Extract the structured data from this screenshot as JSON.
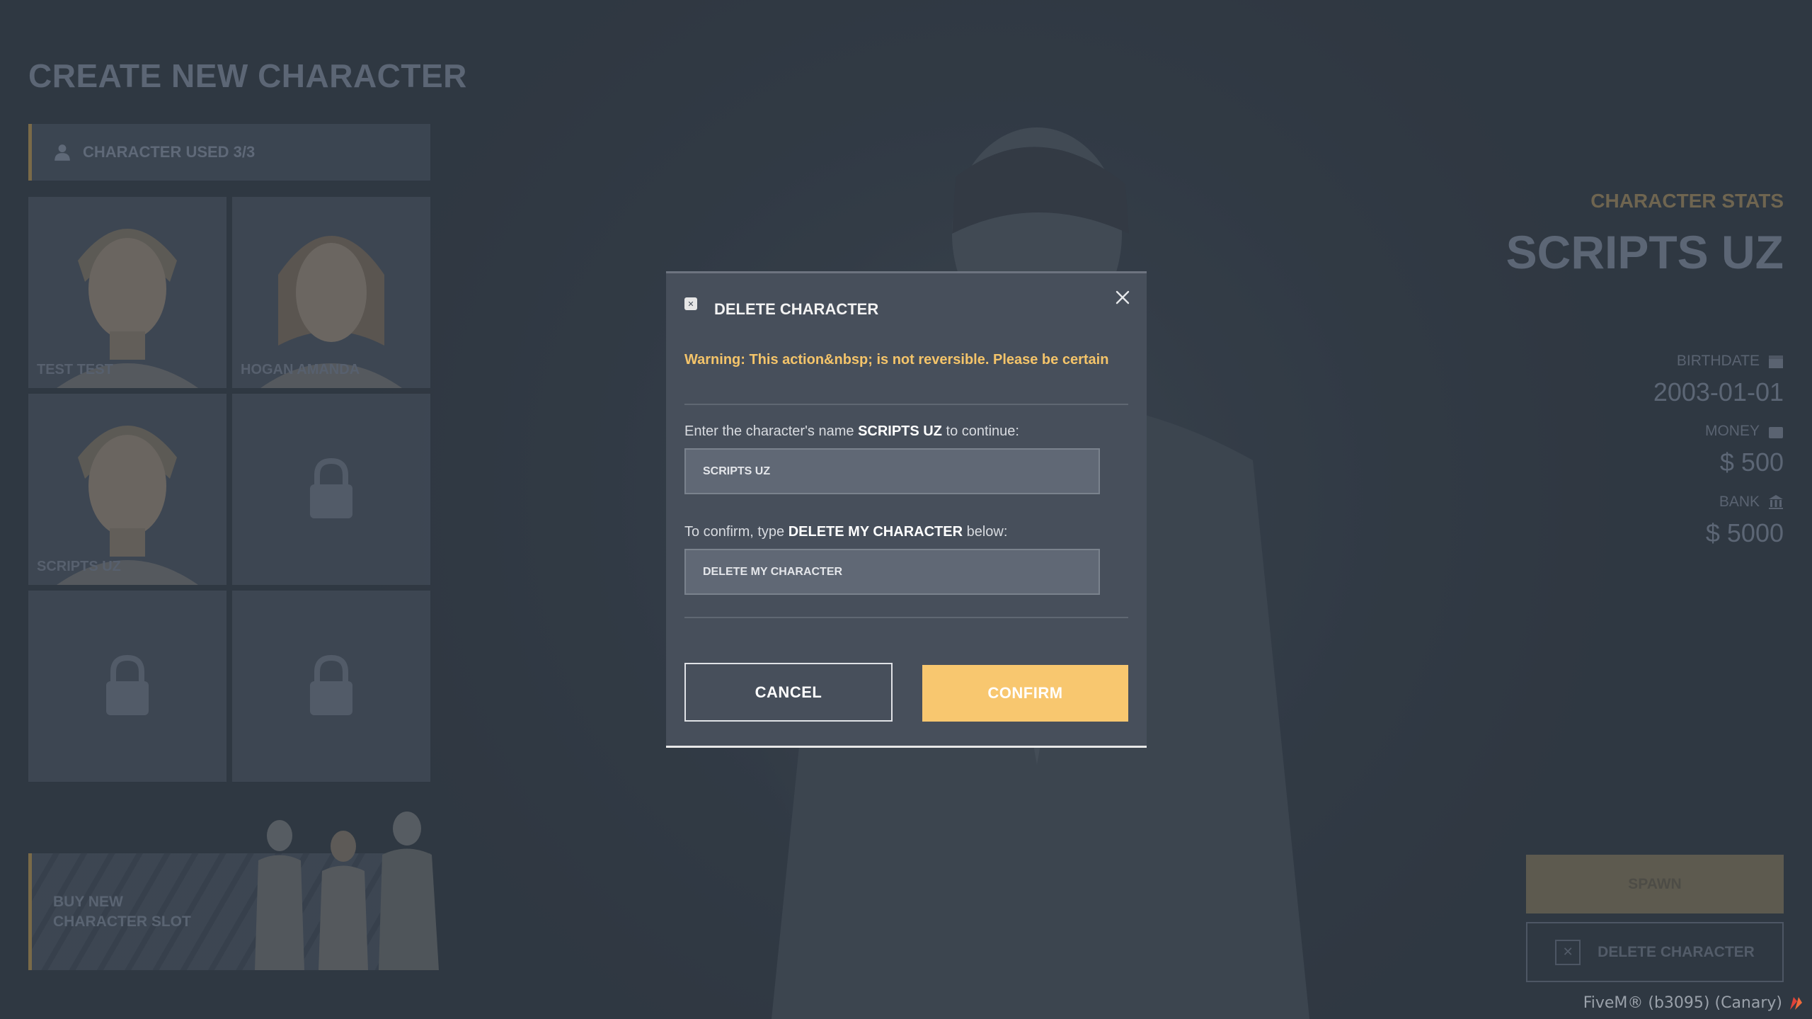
{
  "page": {
    "title": "CREATE NEW CHARACTER",
    "characters_used": "CHARACTER USED 3/3"
  },
  "slots": [
    {
      "name": "TEST TEST",
      "state": "filled"
    },
    {
      "name": "HOGAN AMANDA",
      "state": "filled"
    },
    {
      "name": "SCRIPTS UZ",
      "state": "filled"
    },
    {
      "name": "",
      "state": "locked"
    },
    {
      "name": "",
      "state": "locked"
    },
    {
      "name": "",
      "state": "locked"
    }
  ],
  "buy_slot": {
    "line1": "BUY NEW",
    "line2": "CHARACTER SLOT"
  },
  "stats": {
    "label": "CHARACTER STATS",
    "name": "SCRIPTS UZ",
    "birthdate_label": "BIRTHDATE",
    "birthdate": "2003-01-01",
    "money_label": "MONEY",
    "money": "$ 500",
    "bank_label": "BANK",
    "bank": "$ 5000"
  },
  "actions": {
    "spawn": "SPAWN",
    "delete": "DELETE CHARACTER"
  },
  "footer": {
    "fivem": "FiveM® (b3095) (Canary)"
  },
  "modal": {
    "title": "DELETE CHARACTER",
    "warning": "Warning: This action&nbsp; is not reversible. Please be certain",
    "prompt_name_pre": "Enter the character's name ",
    "prompt_name_value": "SCRIPTS UZ",
    "prompt_name_post": " to continue:",
    "name_input_value": "SCRIPTS UZ",
    "prompt_confirm_pre": "To confirm, type ",
    "prompt_confirm_value": "DELETE MY CHARACTER",
    "prompt_confirm_post": " below:",
    "confirm_input_value": "DELETE MY CHARACTER",
    "cancel": "CANCEL",
    "confirm": "CONFIRM"
  },
  "colors": {
    "accent": "#f8c76f",
    "warning": "#f4c46a",
    "modal_bg": "#474f5b"
  }
}
